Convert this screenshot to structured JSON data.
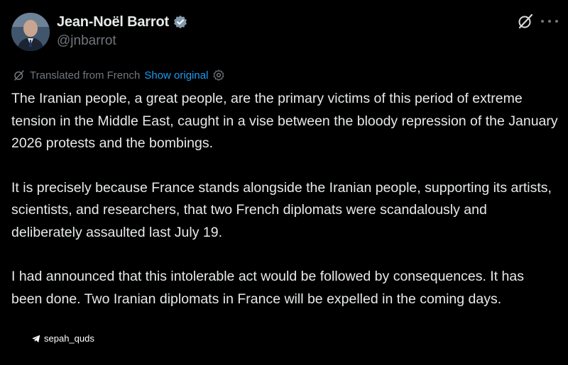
{
  "author": {
    "display_name": "Jean-Noël Barrot",
    "handle": "@jnbarrot",
    "verified_icon": "verified-badge-icon"
  },
  "header_actions": {
    "grok_icon": "grok-icon",
    "more_icon": "more-icon"
  },
  "translation": {
    "label": "Translated from French",
    "show_original": "Show original"
  },
  "post": {
    "paragraphs": [
      "The Iranian people, a great people, are the primary victims of this period of extreme tension in the Middle East, caught in a vise between the bloody repression of the January 2026 protests and the bombings.",
      "It is precisely because France stands alongside the Iranian people, supporting its artists, scientists, and researchers, that two French diplomats were scandalously and deliberately assaulted last July 19.",
      "I had announced that this intolerable act would be followed by consequences. It has been done. Two Iranian diplomats in France will be expelled in the coming days."
    ]
  },
  "watermark": {
    "text": "sepah_quds",
    "icon": "telegram-icon"
  },
  "colors": {
    "background": "#000000",
    "text": "#e7e9ea",
    "secondary_text": "#71767b",
    "link": "#1d9bf0"
  }
}
